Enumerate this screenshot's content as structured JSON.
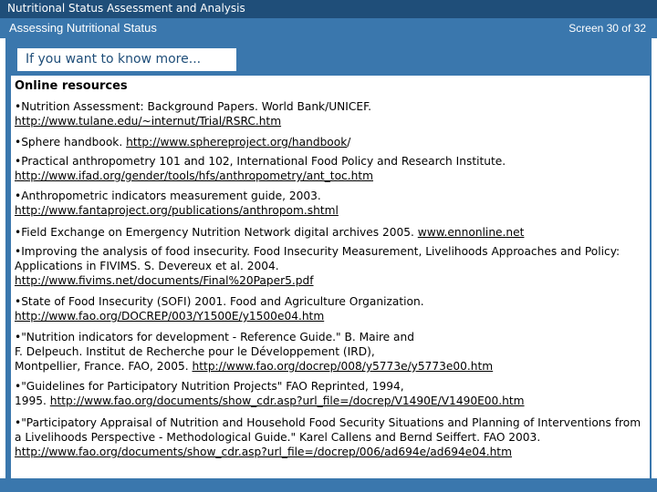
{
  "header": {
    "course_title": "Nutritional Status Assessment and Analysis",
    "section_title": "Assessing Nutritional Status",
    "screen_counter": "Screen 30 of 32"
  },
  "tab": {
    "label": "If you want to know more..."
  },
  "colors": {
    "dark_blue": "#1f4e79",
    "mid_blue": "#3a77ad",
    "background": "#ffffff"
  },
  "resources": {
    "heading": "Online resources",
    "items": [
      {
        "text": "•Nutrition Assessment: Background Papers. World Bank/UNICEF.",
        "link": "http://www.tulane.edu/~internut/Trial/RSRC.htm",
        "after": ""
      },
      {
        "text": "•Sphere handbook. ",
        "link": "http://www.sphereproject.org/handbook",
        "after": "/"
      },
      {
        "text": "•Practical anthropometry 101 and 102, International Food Policy and Research Institute.",
        "link": "http://www.ifad.org/gender/tools/hfs/anthropometry/ant_toc.htm",
        "after": ""
      },
      {
        "text": "•Anthropometric indicators measurement guide, 2003.",
        "link": "http://www.fantaproject.org/publications/anthropom.shtml",
        "after": ""
      },
      {
        "text": "•Field Exchange on Emergency Nutrition Network digital archives 2005. ",
        "link": "www.ennonline.net",
        "after": ""
      },
      {
        "text": "•Improving the analysis of food insecurity. Food Insecurity Measurement, Livelihoods Approaches and Policy: Applications in FIVIMS. S. Devereux et al. 2004.",
        "link": "http://www.fivims.net/documents/Final%20Paper5.pdf",
        "after": ""
      },
      {
        "text": "•State of Food Insecurity (SOFI) 2001. Food  and Agriculture Organization.",
        "link": "http://www.fao.org/DOCREP/003/Y1500E/y1500e04.htm",
        "after": ""
      },
      {
        "text": "•\"Nutrition indicators for development - Reference Guide.\" B. Maire and\nF. Delpeuch. Institut de Recherche pour le Développement (IRD),\nMontpellier, France. FAO, 2005. ",
        "link": "http://www.fao.org/docrep/008/y5773e/y5773e00.htm",
        "after": ""
      },
      {
        "text": "•\"Guidelines for Participatory Nutrition Projects\" FAO Reprinted, 1994,\n1995. ",
        "link": "http://www.fao.org/documents/show_cdr.asp?url_file=/docrep/V1490E/V1490E00.htm",
        "after": ""
      },
      {
        "text": "•\"Participatory Appraisal of Nutrition and Household Food Security Situations and Planning of Interventions from a Livelihoods Perspective - Methodological Guide.\" Karel Callens and Bernd Seiffert. FAO 2003.",
        "link": "http://www.fao.org/documents/show_cdr.asp?url_file=/docrep/006/ad694e/ad694e04.htm",
        "after": ""
      }
    ]
  }
}
